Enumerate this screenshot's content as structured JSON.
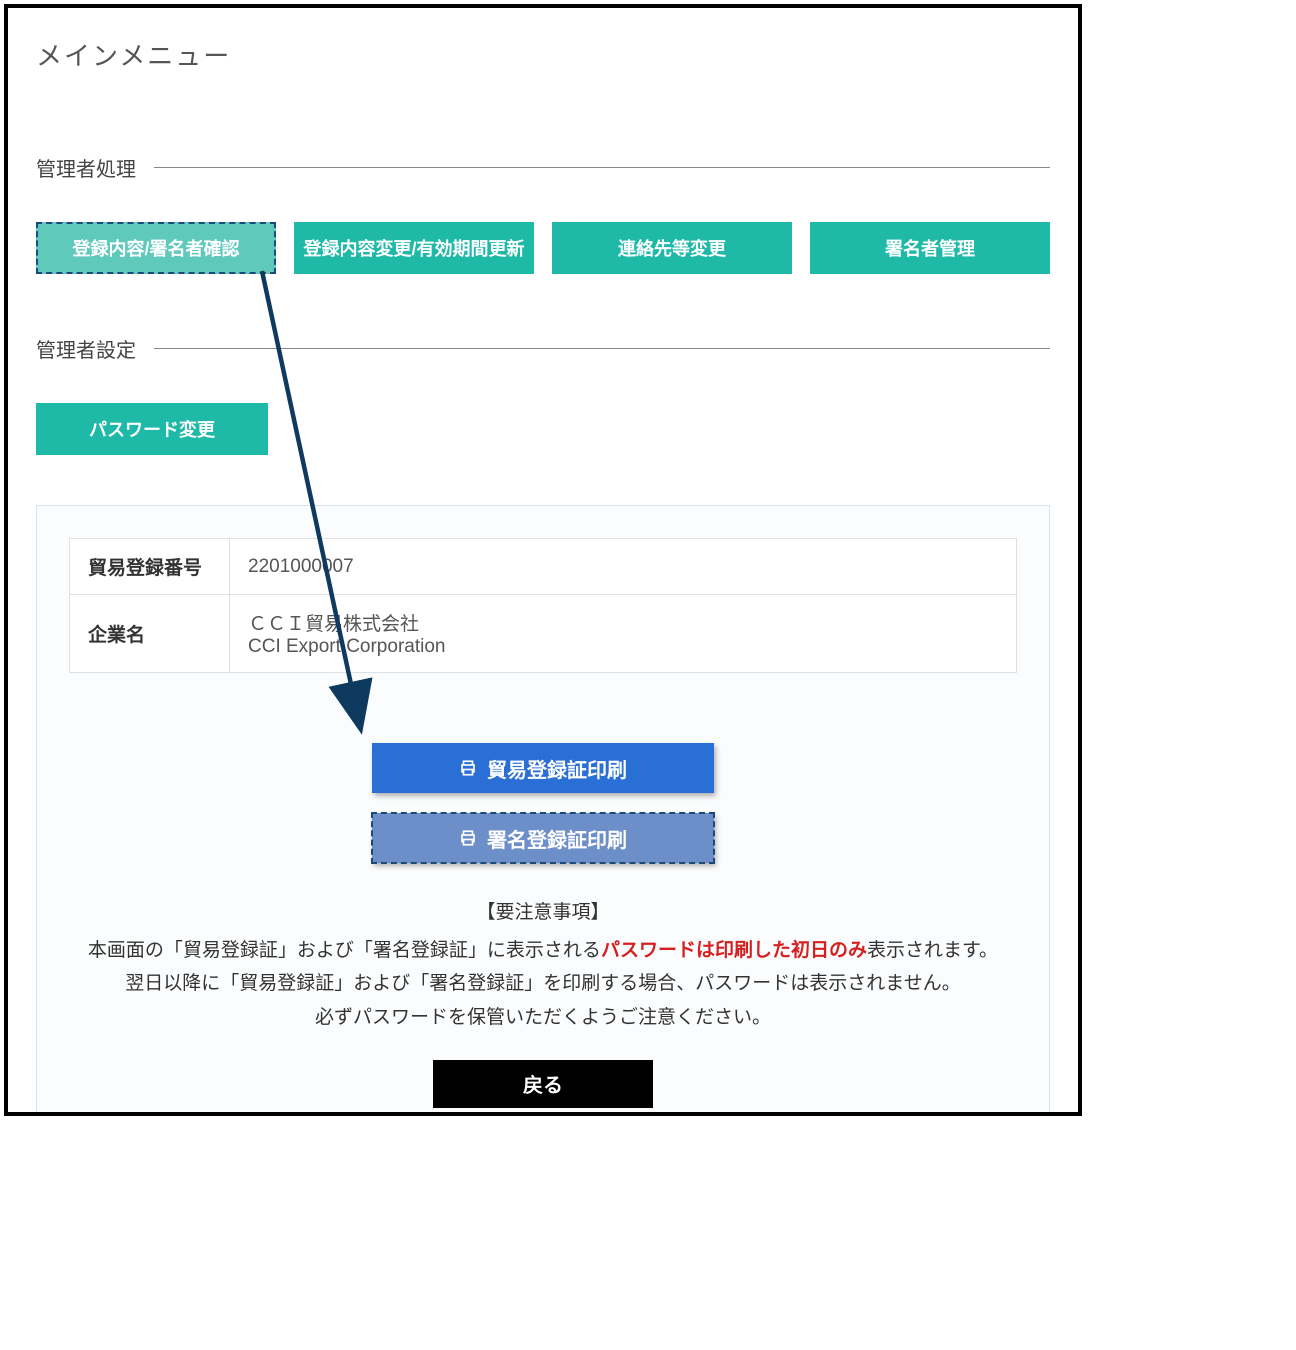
{
  "page_title": "メインメニュー",
  "sections": {
    "admin_process": {
      "label": "管理者処理",
      "buttons": [
        "登録内容/署名者確認",
        "登録内容変更/有効期間更新",
        "連絡先等変更",
        "署名者管理"
      ]
    },
    "admin_settings": {
      "label": "管理者設定",
      "buttons": [
        "パスワード変更"
      ]
    }
  },
  "detail_panel": {
    "rows": [
      {
        "label": "貿易登録番号",
        "value": "2201000007"
      },
      {
        "label": "企業名",
        "value_jp": "ＣＣＩ貿易株式会社",
        "value_en": "CCI Export Corporation"
      }
    ],
    "print_buttons": {
      "trade": "貿易登録証印刷",
      "signature": "署名登録証印刷"
    },
    "notice": {
      "title": "【要注意事項】",
      "line1_pre": "本画面の「貿易登録証」および「署名登録証」に表示される",
      "line1_red": "パスワードは印刷した初日のみ",
      "line1_post": "表示されます。",
      "line2": "翌日以降に「貿易登録証」および「署名登録証」を印刷する場合、パスワードは表示されません。",
      "line3": "必ずパスワードを保管いただくようご注意ください。"
    },
    "back_label": "戻る"
  }
}
